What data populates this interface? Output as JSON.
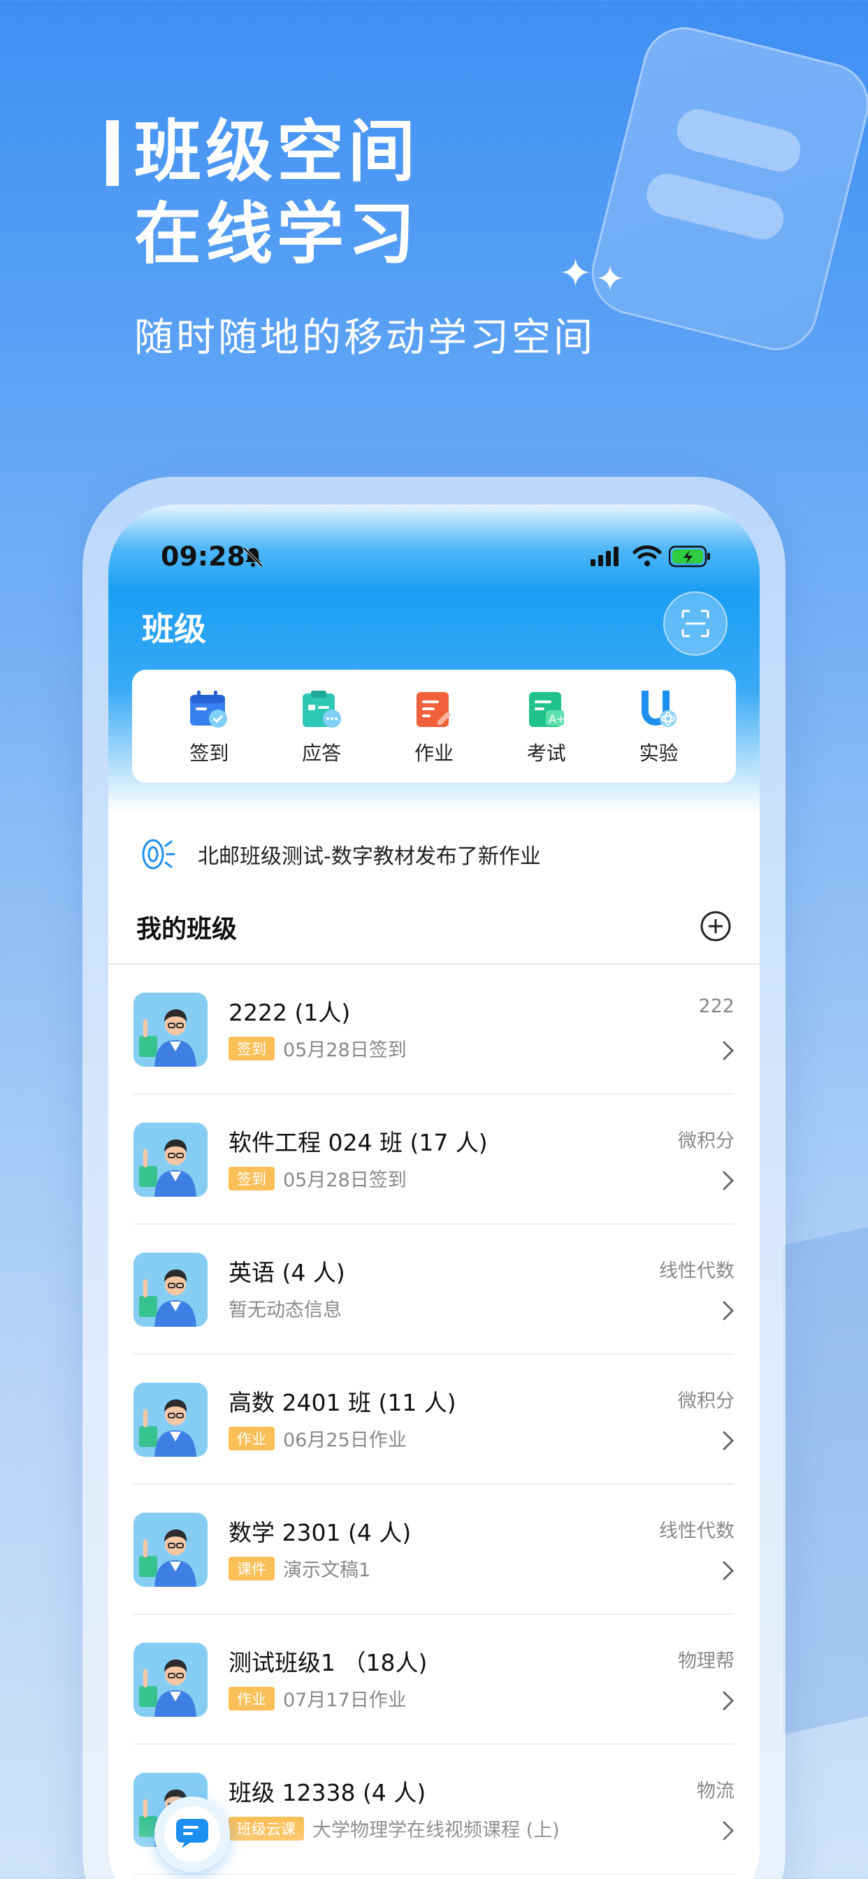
{
  "hero": {
    "title_line1": "班级空间",
    "title_line2": "在线学习",
    "subtitle": "随时随地的移动学习空间"
  },
  "status_bar": {
    "time": "09:28"
  },
  "header": {
    "title": "班级"
  },
  "quick_actions": [
    {
      "label": "签到",
      "icon": "checkin-icon"
    },
    {
      "label": "应答",
      "icon": "answer-icon"
    },
    {
      "label": "作业",
      "icon": "homework-icon"
    },
    {
      "label": "考试",
      "icon": "exam-icon"
    },
    {
      "label": "实验",
      "icon": "experiment-icon"
    }
  ],
  "notice": {
    "text": "北邮班级测试-数字教材发布了新作业"
  },
  "my_classes": {
    "title": "我的班级"
  },
  "classes": [
    {
      "name": "2222 (1人)",
      "course": "222",
      "tag": "签到",
      "info": "05月28日签到"
    },
    {
      "name": "软件工程 024 班 (17 人)",
      "course": "微积分",
      "tag": "签到",
      "info": "05月28日签到"
    },
    {
      "name": "英语 (4 人)",
      "course": "线性代数",
      "tag": "",
      "info": "暂无动态信息"
    },
    {
      "name": "高数 2401 班 (11 人)",
      "course": "微积分",
      "tag": "作业",
      "info": "06月25日作业"
    },
    {
      "name": "数学 2301 (4 人)",
      "course": "线性代数",
      "tag": "课件",
      "info": "演示文稿1"
    },
    {
      "name": "测试班级1 （18人)",
      "course": "物理帮",
      "tag": "作业",
      "info": "07月17日作业"
    },
    {
      "name": "班级 12338 (4 人)",
      "course": "物流",
      "tag": "班级云课",
      "info": "大学物理学在线视频课程 (上)"
    }
  ],
  "colors": {
    "accent": "#1a9ef4",
    "tag": "#fbbf57"
  }
}
